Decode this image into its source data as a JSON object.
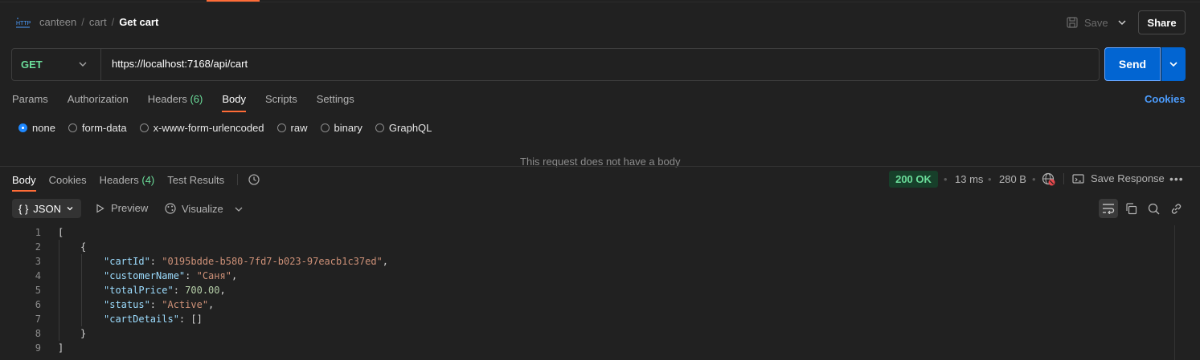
{
  "header": {
    "icon": "http-icon",
    "breadcrumb": [
      "canteen",
      "cart",
      "Get cart"
    ],
    "separator": "/",
    "save_label": "Save",
    "share_label": "Share"
  },
  "request": {
    "method": "GET",
    "url": "https://localhost:7168/api/cart",
    "send_label": "Send"
  },
  "request_tabs": {
    "params": "Params",
    "authorization": "Authorization",
    "headers": "Headers",
    "headers_count": "(6)",
    "body": "Body",
    "scripts": "Scripts",
    "settings": "Settings",
    "active": "Body",
    "cookies_link": "Cookies"
  },
  "body_types": {
    "selected": "none",
    "options": [
      "none",
      "form-data",
      "x-www-form-urlencoded",
      "raw",
      "binary",
      "GraphQL"
    ]
  },
  "no_body_message": "This request does not have a body",
  "response_tabs": {
    "body": "Body",
    "cookies": "Cookies",
    "headers": "Headers",
    "headers_count": "(4)",
    "test_results": "Test Results",
    "active": "Body"
  },
  "response_meta": {
    "status": "200 OK",
    "time": "13 ms",
    "size": "280 B",
    "save_response": "Save Response",
    "more": "•••"
  },
  "response_toolbar": {
    "format": "JSON",
    "format_icon": "{ }",
    "preview": "Preview",
    "visualize": "Visualize"
  },
  "code": {
    "line_numbers": [
      "1",
      "2",
      "3",
      "4",
      "5",
      "6",
      "7",
      "8",
      "9"
    ],
    "lines": [
      "[",
      "{",
      "\"cartId\": \"0195bdde-b580-7fd7-b023-97eacb1c37ed\",",
      "\"customerName\": \"Саня\",",
      "\"totalPrice\": 700.00,",
      "\"status\": \"Active\",",
      "\"cartDetails\": []",
      "}",
      "]"
    ],
    "cartId_key": "\"cartId\"",
    "cartId_val": "\"0195bdde-b580-7fd7-b023-97eacb1c37ed\"",
    "customerName_key": "\"customerName\"",
    "customerName_val": "\"Саня\"",
    "totalPrice_key": "\"totalPrice\"",
    "totalPrice_val": "700.00",
    "status_key": "\"status\"",
    "status_val": "\"Active\"",
    "cartDetails_key": "\"cartDetails\"",
    "cartDetails_val": "[]"
  },
  "colors": {
    "accent": "#ff6c37",
    "send_blue": "#0265d2",
    "get_green": "#6bdd9a",
    "link_blue": "#4c9dff"
  }
}
